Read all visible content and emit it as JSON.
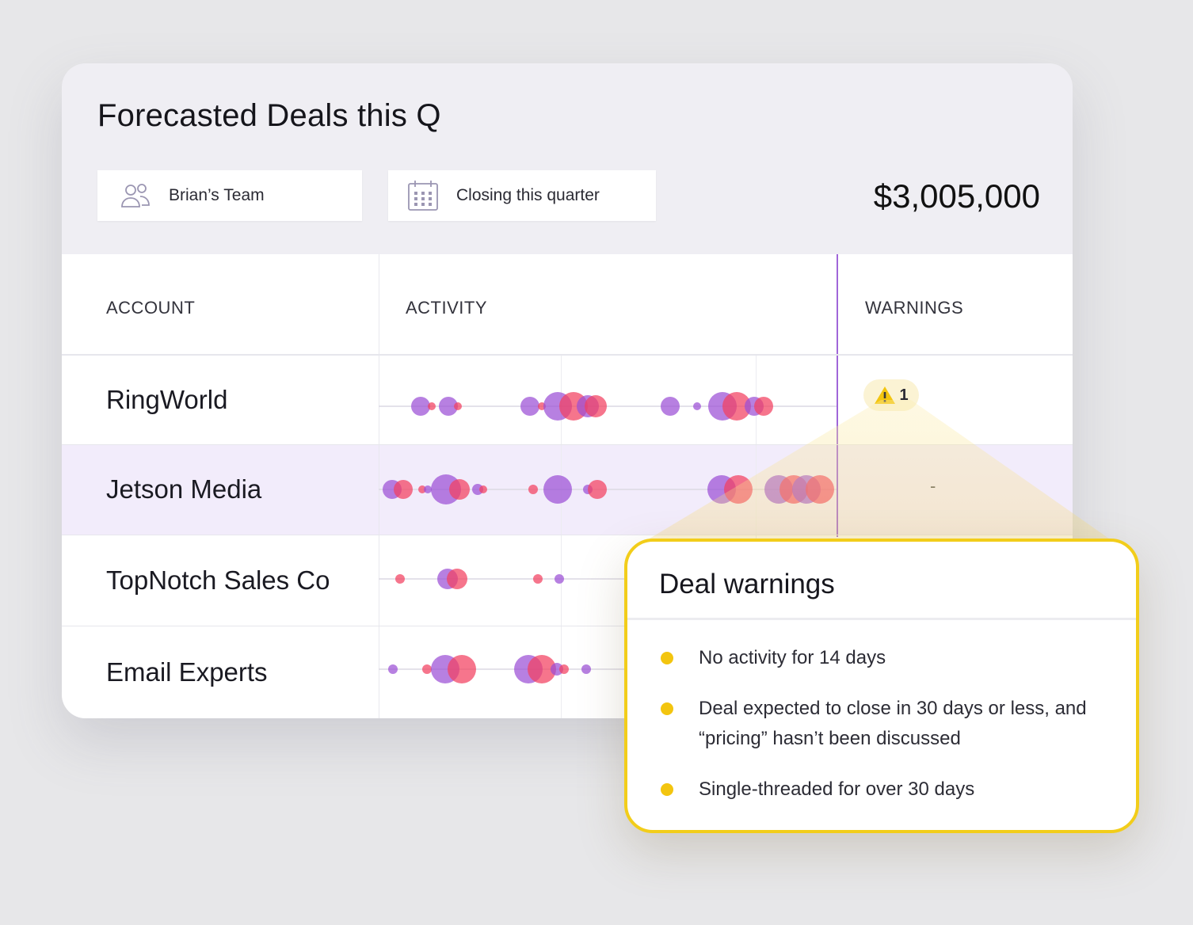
{
  "card": {
    "title": "Forecasted Deals this Q",
    "filters": {
      "team": {
        "label": "Brian’s Team",
        "icon": "people-icon"
      },
      "period": {
        "label": "Closing this quarter",
        "icon": "calendar-icon"
      }
    },
    "total": "$3,005,000"
  },
  "table": {
    "columns": {
      "account": "ACCOUNT",
      "activity": "ACTIVITY",
      "warnings": "WARNINGS"
    },
    "rows": [
      {
        "account": "RingWorld",
        "warning_icon": "warning-triangle-icon",
        "warning_count": "1",
        "highlighted": false
      },
      {
        "account": "Jetson Media",
        "warning_text": "-",
        "highlighted": true
      },
      {
        "account": "TopNotch Sales Co",
        "highlighted": false
      },
      {
        "account": "Email Experts",
        "highlighted": false
      }
    ]
  },
  "popup": {
    "title": "Deal warnings",
    "items": [
      "No activity for 14 days",
      "Deal expected to close in 30 days or less, and “pricing” hasn’t been discussed",
      "Single-threaded for over 30 days"
    ]
  },
  "colors": {
    "accent_purple": "#9b4fd6",
    "accent_pink": "#f2405f",
    "highlight_row": "#f2ecfb",
    "warning_yellow": "#f2cd1a"
  }
}
